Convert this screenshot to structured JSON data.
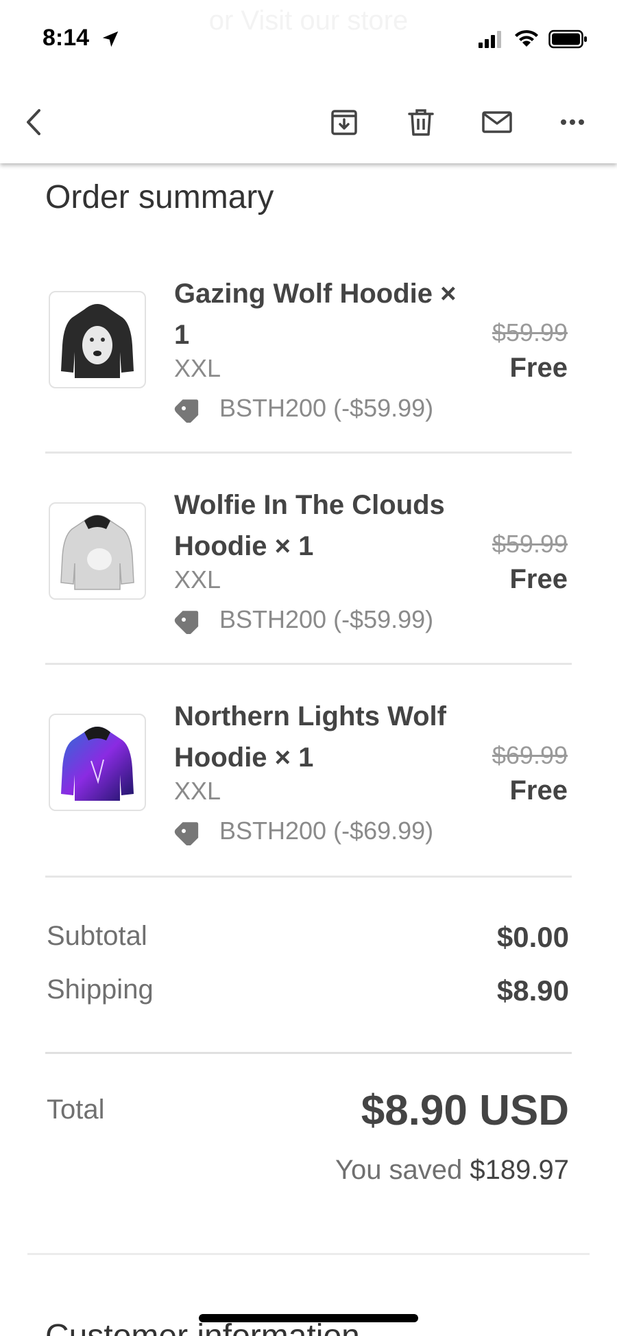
{
  "status_bar": {
    "time": "8:14",
    "ghost_text": "or Visit our store",
    "icons": [
      "location-arrow-icon",
      "cellular-signal-icon",
      "wifi-icon",
      "battery-icon"
    ]
  },
  "toolbar": {
    "icons": [
      "back-chevron-icon",
      "archive-icon",
      "trash-icon",
      "mail-icon",
      "more-icon"
    ]
  },
  "order_summary": {
    "title": "Order summary",
    "items": [
      {
        "name": "Gazing Wolf Hoodie × 1",
        "variant": "XXL",
        "discount": "BSTH200 (-$59.99)",
        "original_price": "$59.99",
        "final_price": "Free",
        "thumb_color": "#2a2a2a"
      },
      {
        "name": "Wolfie In The Clouds Hoodie × 1",
        "variant": "XXL",
        "discount": "BSTH200 (-$59.99)",
        "original_price": "$59.99",
        "final_price": "Free",
        "thumb_color": "#cfcfcf"
      },
      {
        "name": "Northern Lights Wolf Hoodie × 1",
        "variant": "XXL",
        "discount": "BSTH200 (-$69.99)",
        "original_price": "$69.99",
        "final_price": "Free",
        "thumb_color": "#5a38c8"
      }
    ],
    "subtotal_label": "Subtotal",
    "subtotal_value": "$0.00",
    "shipping_label": "Shipping",
    "shipping_value": "$8.90",
    "total_label": "Total",
    "total_value": "$8.90 USD",
    "saved_prefix": "You saved ",
    "saved_value": "$189.97"
  },
  "next_section_title": "Customer information"
}
